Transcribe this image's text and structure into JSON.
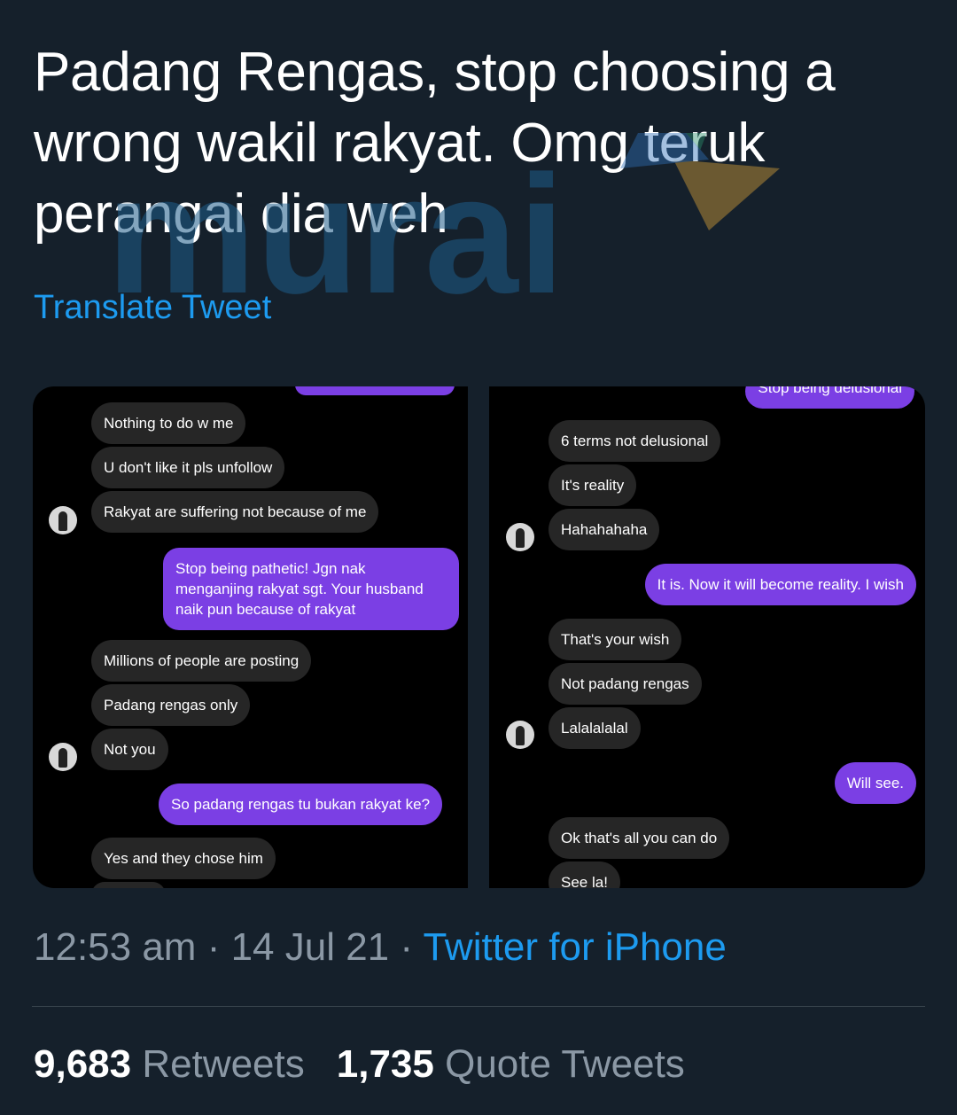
{
  "tweet": {
    "text": "Padang Rengas, stop choosing a wrong wakil rakyat. Omg teruk perangai dia weh",
    "translate_label": "Translate Tweet",
    "watermark": "murai",
    "time": "12:53 am",
    "date": "14 Jul 21",
    "separator": " · ",
    "source": "Twitter for iPhone",
    "retweets_count": "9,683",
    "retweets_label": "Retweets",
    "quotes_count": "1,735",
    "quotes_label": "Quote Tweets"
  },
  "colors": {
    "background": "#15202b",
    "accent": "#1d9bf0",
    "sent_bubble": "#7b3fe4",
    "received_bubble": "#262626",
    "muted_text": "#8b98a5"
  },
  "screenshot_left": {
    "messages": [
      {
        "side": "received",
        "text": "Nothing to do w me"
      },
      {
        "side": "received",
        "text": "U don't like it pls unfollow"
      },
      {
        "side": "received",
        "text": "Rakyat are suffering not because of me"
      },
      {
        "side": "sent",
        "text": "Stop being pathetic! Jgn nak menganjing rakyat sgt. Your husband naik pun because of rakyat"
      },
      {
        "side": "received",
        "text": "Millions of people are posting"
      },
      {
        "side": "received",
        "text": "Padang rengas only"
      },
      {
        "side": "received",
        "text": "Not you"
      },
      {
        "side": "sent",
        "text": "So padang rengas tu bukan rakyat ke?"
      },
      {
        "side": "received",
        "text": "Yes and they chose him"
      }
    ]
  },
  "screenshot_right": {
    "messages": [
      {
        "side": "sent",
        "text": "Stop being delusional"
      },
      {
        "side": "received",
        "text": "6 terms not delusional"
      },
      {
        "side": "received",
        "text": "It's reality"
      },
      {
        "side": "received",
        "text": "Hahahahaha"
      },
      {
        "side": "sent",
        "text": "It is. Now it will become reality. I wish"
      },
      {
        "side": "received",
        "text": "That's your wish"
      },
      {
        "side": "received",
        "text": "Not padang rengas"
      },
      {
        "side": "received",
        "text": "Lalalalalal"
      },
      {
        "side": "sent",
        "text": "Will see."
      },
      {
        "side": "received",
        "text": "Ok that's all you can do"
      },
      {
        "side": "received",
        "text": "See la!"
      }
    ]
  }
}
